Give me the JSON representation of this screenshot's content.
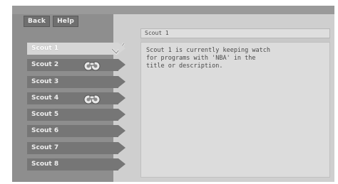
{
  "nav": {
    "back_label": "Back",
    "help_label": "Help"
  },
  "scouts": [
    {
      "label": "Scout 1",
      "selected": true,
      "checked": true,
      "watch_icon": false
    },
    {
      "label": "Scout 2",
      "selected": false,
      "checked": false,
      "watch_icon": true
    },
    {
      "label": "Scout 3",
      "selected": false,
      "checked": false,
      "watch_icon": false
    },
    {
      "label": "Scout 4",
      "selected": false,
      "checked": false,
      "watch_icon": true
    },
    {
      "label": "Scout 5",
      "selected": false,
      "checked": false,
      "watch_icon": false
    },
    {
      "label": "Scout 6",
      "selected": false,
      "checked": false,
      "watch_icon": false
    },
    {
      "label": "Scout 7",
      "selected": false,
      "checked": false,
      "watch_icon": false
    },
    {
      "label": "Scout 8",
      "selected": false,
      "checked": false,
      "watch_icon": false
    }
  ],
  "detail": {
    "title": "Scout 1",
    "description": "Scout 1 is currently keeping watch\nfor programs with 'NBA' in the\ntitle or description."
  },
  "icons": {
    "check": "checkmark-icon",
    "watch": "binoculars-icon"
  }
}
